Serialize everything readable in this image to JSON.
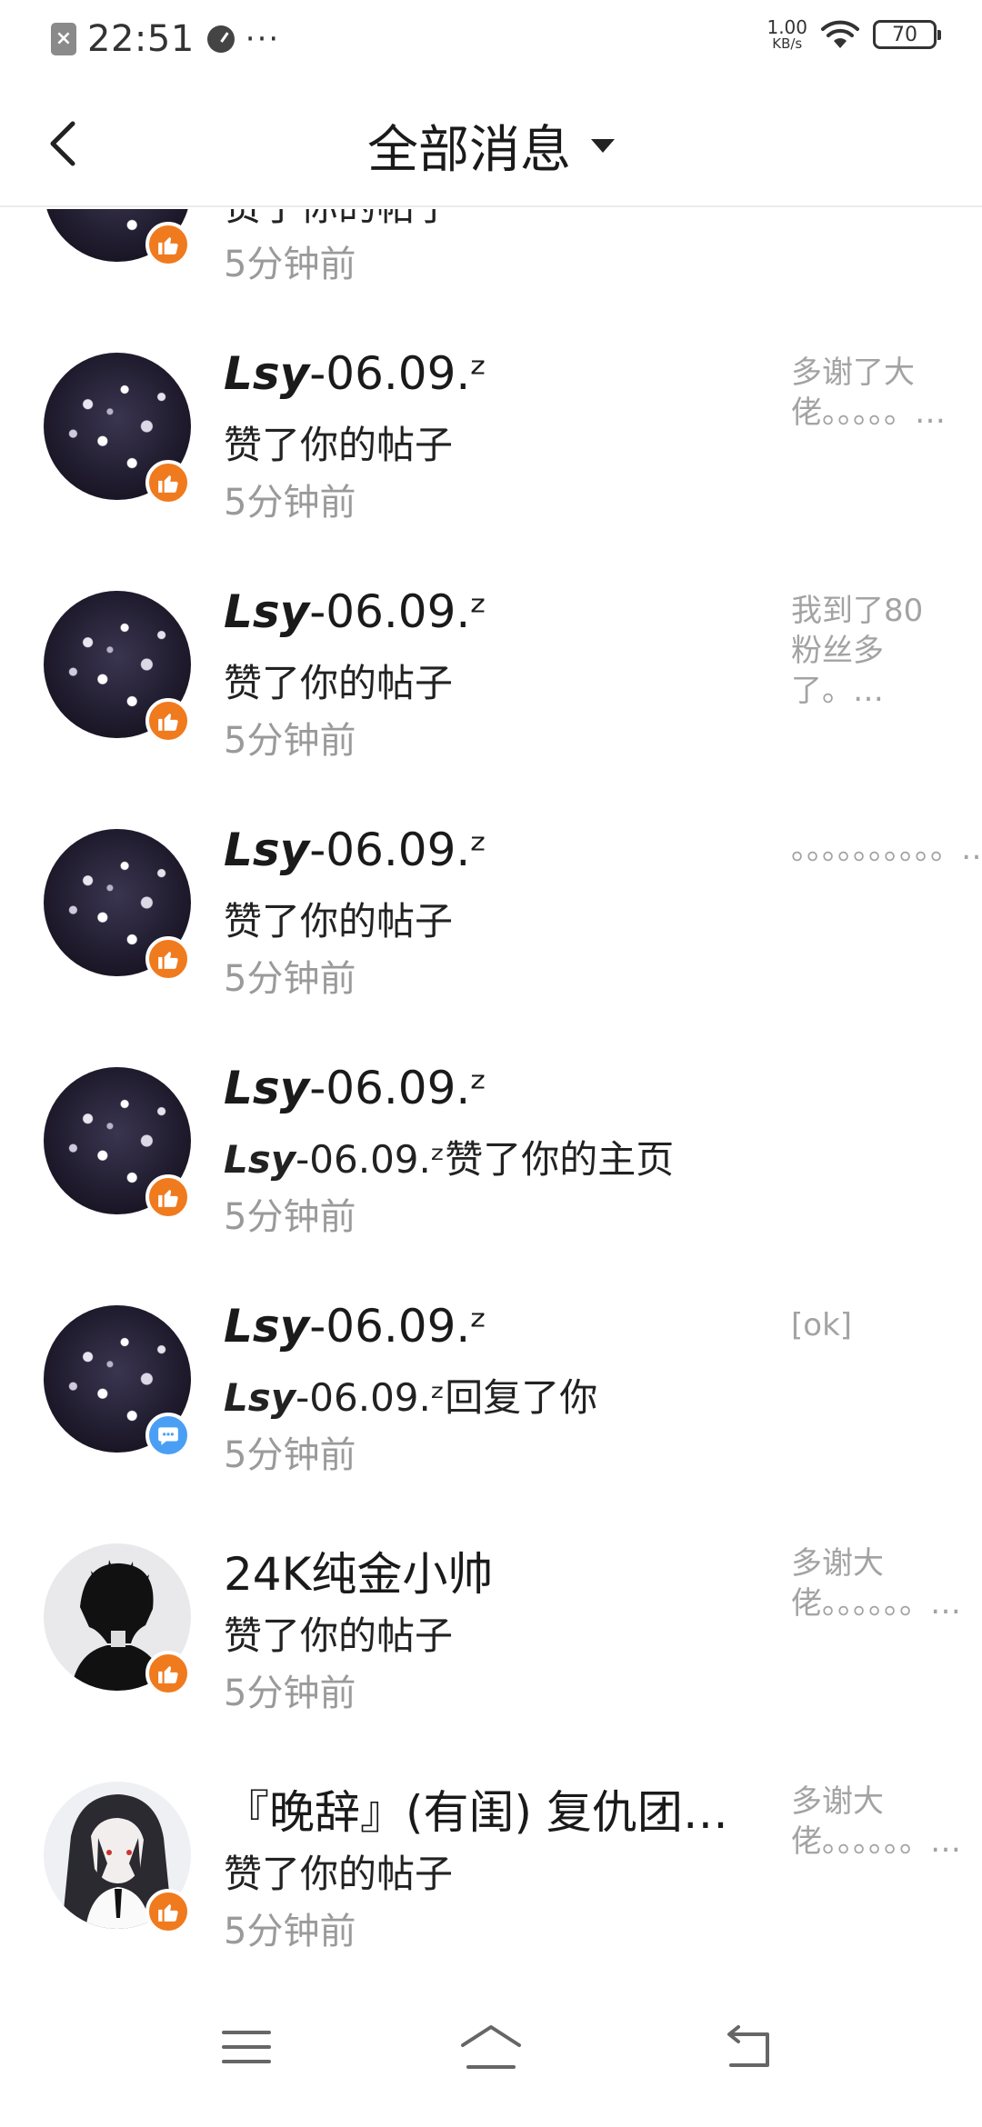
{
  "status_bar": {
    "time": "22:51",
    "noti_icon_text": "×",
    "more": "···",
    "net_speed": "1.00",
    "net_unit": "KB/s",
    "battery": "70"
  },
  "header": {
    "title": "全部消息"
  },
  "items": [
    {
      "name_bold": "",
      "name": "",
      "action_bold": "",
      "action": "赞了你的帖子",
      "time": "5分钟前",
      "preview": "？？…"
    },
    {
      "name_bold": "Lsy",
      "name": "-06.09.ᶻ",
      "action_bold": "",
      "action": "赞了你的帖子",
      "time": "5分钟前",
      "preview": "多谢了大佬。。。。。…"
    },
    {
      "name_bold": "Lsy",
      "name": "-06.09.ᶻ",
      "action_bold": "",
      "action": "赞了你的帖子",
      "time": "5分钟前",
      "preview": "我到了80粉丝多了。…"
    },
    {
      "name_bold": "Lsy",
      "name": "-06.09.ᶻ",
      "action_bold": "",
      "action": "赞了你的帖子",
      "time": "5分钟前",
      "preview": "。。。。。。。。。。…"
    },
    {
      "name_bold": "Lsy",
      "name": "-06.09.ᶻ",
      "action_bold": "Lsy",
      "action": "-06.09.ᶻ赞了你的主页",
      "time": "5分钟前",
      "preview": ""
    },
    {
      "name_bold": "Lsy",
      "name": "-06.09.ᶻ",
      "action_bold": "Lsy",
      "action": "-06.09.ᶻ回复了你",
      "time": "5分钟前",
      "preview": "[ok]"
    },
    {
      "name_bold": "",
      "name": "24K纯金小帅",
      "action_bold": "",
      "action": "赞了你的帖子",
      "time": "5分钟前",
      "preview": "多谢大佬。。。。。。…"
    },
    {
      "name_bold": "",
      "name": "『晚辞』(有闺) 复仇团…",
      "action_bold": "",
      "action": "赞了你的帖子",
      "time": "5分钟前",
      "preview": "多谢大佬。。。。。。…"
    }
  ],
  "icons": {
    "like_badge_color": "#f07a1e",
    "reply_badge_color": "#4a9ff5"
  }
}
